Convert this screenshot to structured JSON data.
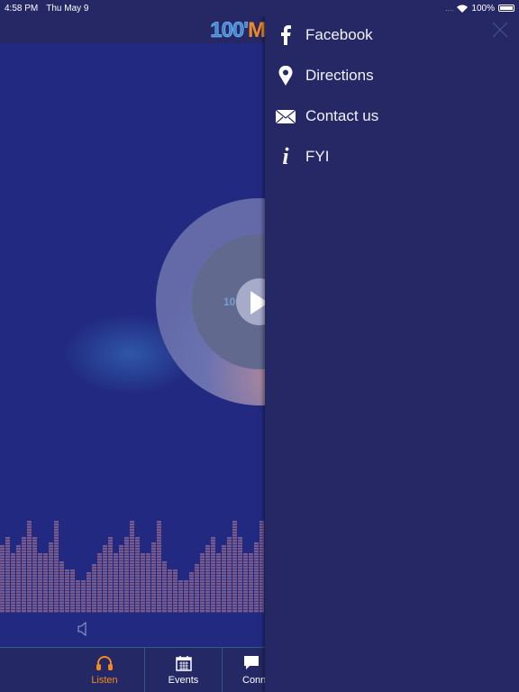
{
  "status": {
    "time": "4:58 PM",
    "date": "Thu May 9",
    "battery": "100%",
    "signal": "....",
    "wifi_icon": "wifi-icon"
  },
  "header": {
    "logo_number": "100",
    "logo_dot": "'",
    "logo_letter": "M"
  },
  "player": {
    "logo": "100'M",
    "state": "paused"
  },
  "equalizer": {
    "color": "#7a5a8a",
    "levels": [
      0.74,
      0.82,
      0.64,
      0.74,
      0.82,
      1,
      0.82,
      0.64,
      0.64,
      0.75,
      1,
      0.56,
      0.48,
      0.48,
      0.34,
      0.34,
      0.44,
      0.52,
      0.64,
      0.74,
      0.82,
      0.64,
      0.74,
      0.82,
      1,
      0.82,
      0.64,
      0.64,
      0.75,
      1,
      0.56,
      0.48,
      0.48,
      0.34,
      0.34,
      0.44,
      0.52,
      0.64,
      0.74,
      0.82,
      0.64,
      0.74,
      0.82,
      1,
      0.82,
      0.64,
      0.64,
      0.75,
      1
    ]
  },
  "tabs": [
    {
      "label": "Listen",
      "icon": "headphones-icon",
      "active": true
    },
    {
      "label": "Events",
      "icon": "calendar-icon"
    },
    {
      "label": "Conn",
      "icon": "chat-bubble-icon"
    }
  ],
  "colors": {
    "accent": "#f08a24",
    "panel": "#252865",
    "background": "#212a80"
  },
  "menu": {
    "items": [
      {
        "label": "Facebook",
        "icon": "facebook-icon"
      },
      {
        "label": "Directions",
        "icon": "map-pin-icon"
      },
      {
        "label": "Contact us",
        "icon": "envelope-icon"
      },
      {
        "label": "FYI",
        "icon": "info-icon"
      }
    ]
  }
}
